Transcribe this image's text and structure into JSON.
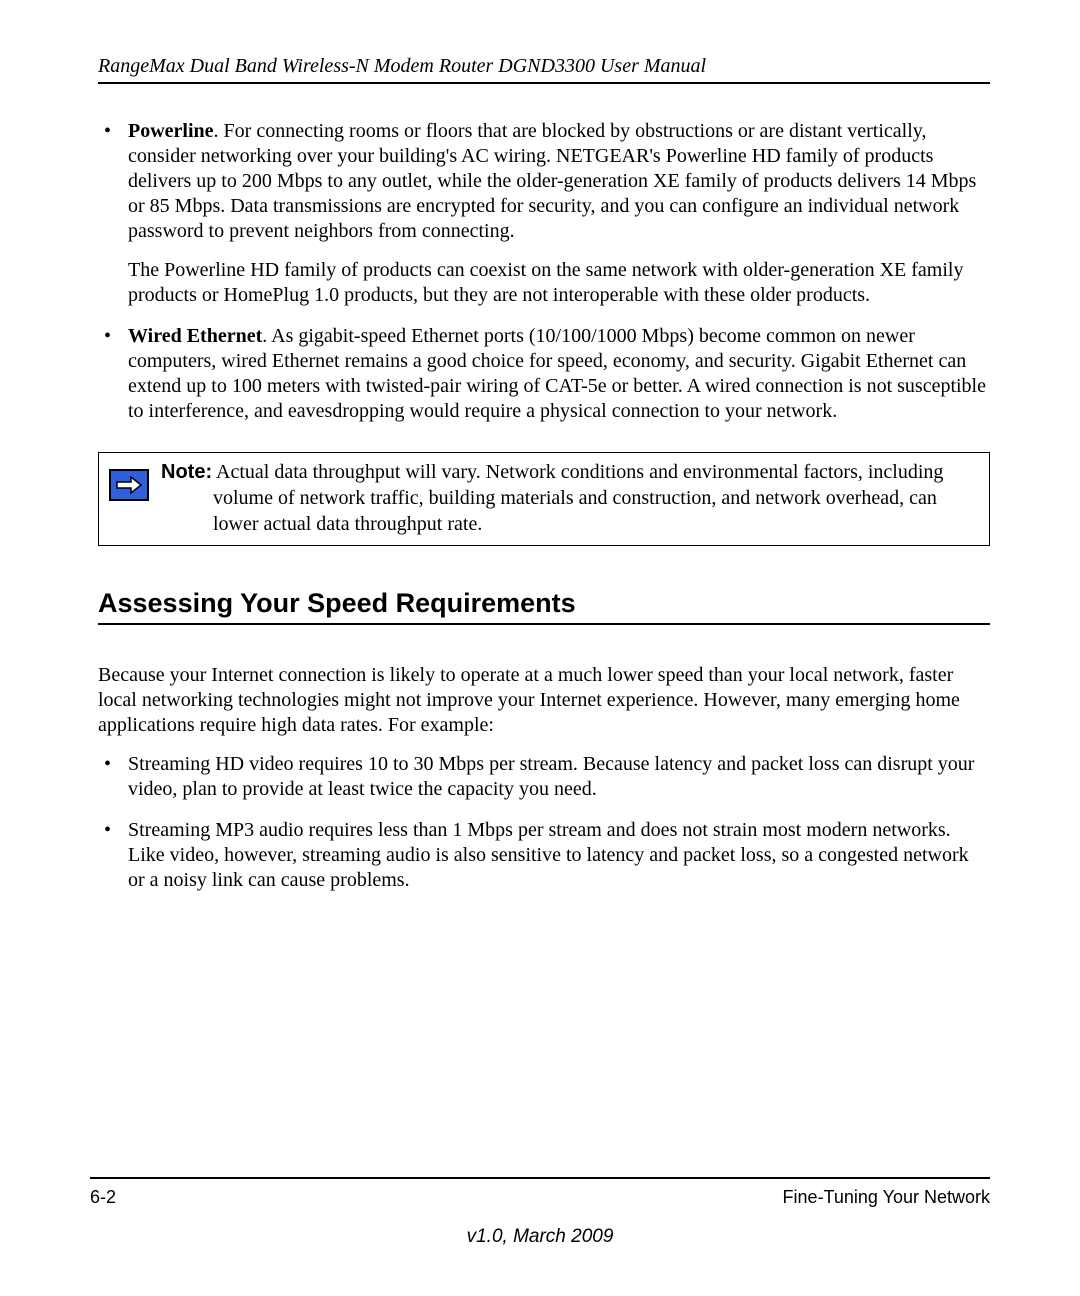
{
  "header": {
    "title": "RangeMax Dual Band Wireless-N Modem Router DGND3300 User Manual"
  },
  "bullets1": {
    "item1": {
      "lead": "Powerline",
      "p1_rest": ". For connecting rooms or floors that are blocked by obstructions or are distant vertically, consider networking over your building's AC wiring. NETGEAR's Powerline HD family of products delivers up to 200 Mbps to any outlet, while the older-generation XE family of products delivers 14 Mbps or 85 Mbps. Data transmissions are encrypted for security, and you can configure an individual network password to prevent neighbors from connecting.",
      "p2": "The Powerline HD family of products can coexist on the same network with older-generation XE family products or HomePlug 1.0 products, but they are not interoperable with these older products."
    },
    "item2": {
      "lead": "Wired Ethernet",
      "p1_rest": ". As gigabit-speed Ethernet ports (10/100/1000 Mbps) become common on newer computers, wired Ethernet remains a good choice for speed, economy, and security. Gigabit Ethernet can extend up to 100 meters with twisted-pair wiring of CAT-5e or better. A wired connection is not susceptible to interference, and eavesdropping would require a physical connection to your network."
    }
  },
  "note": {
    "label": "Note:",
    "text": " Actual data throughput will vary. Network conditions and environmental factors, including volume of network traffic, building materials and construction, and network overhead, can lower actual data throughput rate."
  },
  "section": {
    "heading": "Assessing Your Speed Requirements",
    "intro": "Because your Internet connection is likely to operate at a much lower speed than your local network, faster local networking technologies might not improve your Internet experience. However, many emerging home applications require high data rates. For example:"
  },
  "bullets2": {
    "item1": "Streaming HD video requires 10 to 30 Mbps per stream. Because latency and packet loss can disrupt your video, plan to provide at least twice the capacity you need.",
    "item2": "Streaming MP3 audio requires less than 1 Mbps per stream and does not strain most modern networks. Like video, however, streaming audio is also sensitive to latency and packet loss, so a congested network or a noisy link can cause problems."
  },
  "footer": {
    "page": "6-2",
    "chapter": "Fine-Tuning Your Network",
    "version": "v1.0, March 2009"
  }
}
